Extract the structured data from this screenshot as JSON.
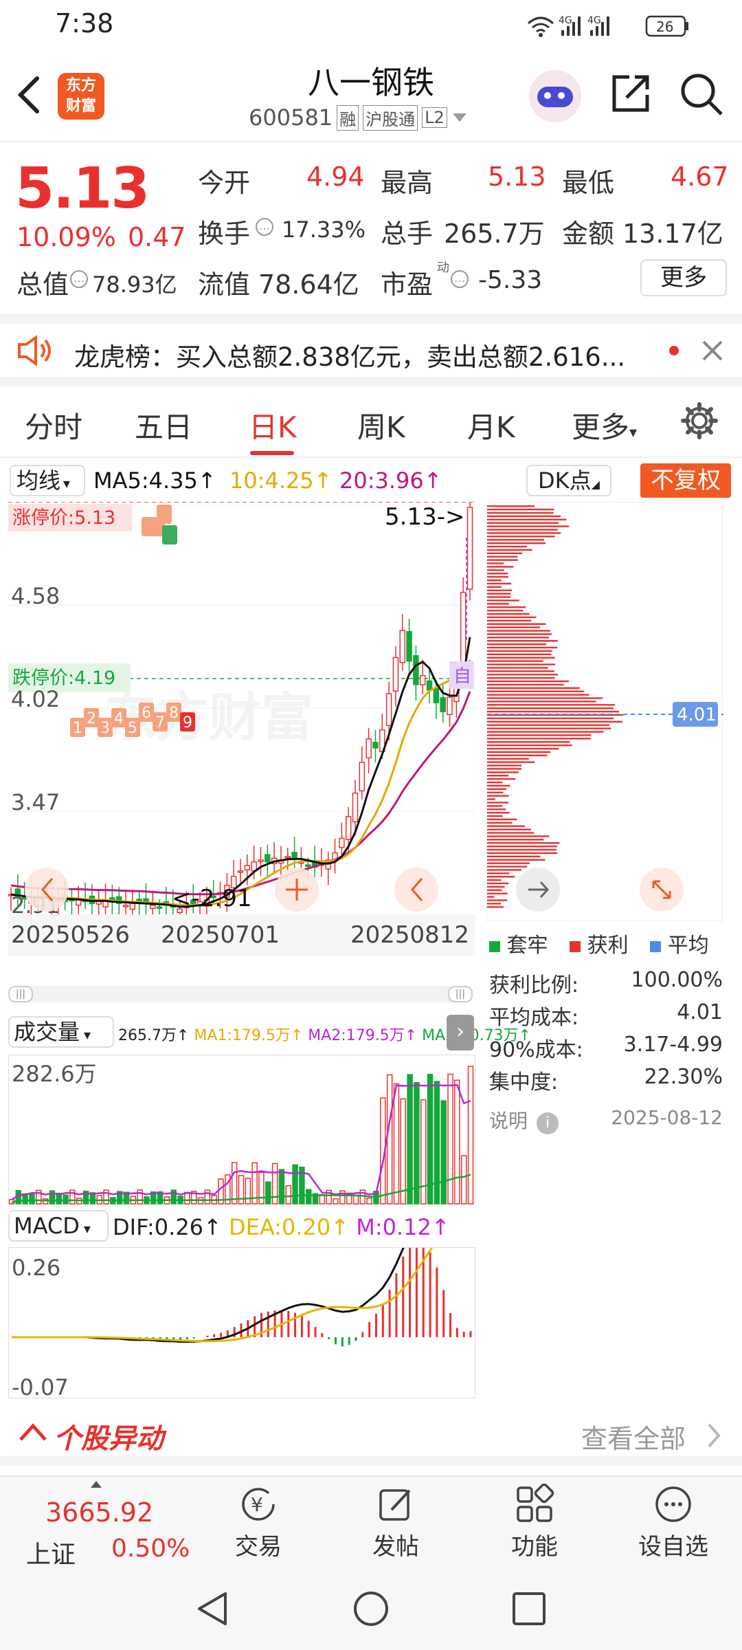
{
  "status": {
    "time": "7:38",
    "signal1": "4G",
    "signal2": "4G",
    "battery": "26"
  },
  "header": {
    "title": "八一钢铁",
    "code": "600581",
    "tag_margin": "融",
    "tag_connect": "沪股通",
    "tag_level": "L2",
    "logo_line1": "东方",
    "logo_line2": "财富"
  },
  "quote": {
    "price": "5.13",
    "change_pct": "10.09%",
    "change_amt": "0.47",
    "open_label": "今开",
    "open": "4.94",
    "high_label": "最高",
    "high": "5.13",
    "low_label": "最低",
    "low": "4.67",
    "turnover_label": "换手",
    "turnover": "17.33%",
    "volume_label": "总手",
    "volume": "265.7万",
    "amount_label": "金额",
    "amount": "13.17亿",
    "mktcap_label": "总值",
    "mktcap": "78.93亿",
    "float_label": "流值",
    "float": "78.64亿",
    "pe_label": "市盈",
    "pe_sup": "动",
    "pe": "-5.33",
    "more_button": "更多"
  },
  "notice": {
    "label": "龙虎榜：",
    "text": "买入总额2.838亿元，卖出总额2.616..."
  },
  "tabs": [
    {
      "label": "分时"
    },
    {
      "label": "五日"
    },
    {
      "label": "日K"
    },
    {
      "label": "周K"
    },
    {
      "label": "月K"
    },
    {
      "label": "更多"
    }
  ],
  "kline": {
    "indicator_select": "均线",
    "ma5": "MA5:4.35",
    "ma10": "10:4.25",
    "ma20": "20:3.96",
    "dk_button": "DK点",
    "adjust_button": "不复权",
    "limit_up_label": "涨停价:5.13",
    "limit_down_label": "跌停价:4.19",
    "price_labels": [
      "4.58",
      "4.02",
      "3.47",
      "2.91"
    ],
    "high_annot": "5.13->",
    "low_annot": "<-2.91",
    "dates": [
      "20250526",
      "20250701",
      "20250812"
    ],
    "nine_markers": [
      "1",
      "2",
      "3",
      "4",
      "5",
      "6",
      "7",
      "8",
      "9"
    ],
    "watermark": "东方财富",
    "today_marker": "自"
  },
  "chip": {
    "avg_cost_label": "4.01",
    "legend": [
      "套牢",
      "获利",
      "平均"
    ],
    "rows": [
      {
        "label": "获利比例:",
        "value": "100.00%"
      },
      {
        "label": "平均成本:",
        "value": "4.01"
      },
      {
        "label": "90%成本:",
        "value": "3.17-4.99"
      },
      {
        "label": "集中度:",
        "value": "22.30%"
      }
    ],
    "note_label": "说明",
    "date": "2025-08-12"
  },
  "volume": {
    "select": "成交量",
    "value": "265.7万",
    "ma1": "MA1:179.5万",
    "ma2": "MA2:179.5万",
    "ma3": "MA3:60.73万",
    "max_label": "282.6万"
  },
  "macd": {
    "select": "MACD",
    "dif": "DIF:0.26",
    "dea": "DEA:0.20",
    "m": "M:0.12",
    "top_label": "0.26",
    "bottom_label": "-0.07"
  },
  "movement": {
    "title": "个股异动",
    "view_all": "查看全部"
  },
  "bottom_bar": {
    "index_value": "3665.92",
    "index_name": "上证",
    "index_pct": "0.50%",
    "trade": "交易",
    "post": "发帖",
    "function": "功能",
    "watchlist": "设自选"
  },
  "colors": {
    "up": "#e8312e",
    "down": "#14a83b",
    "ma5": "#000000",
    "ma10": "#e6a800",
    "ma20": "#c0187a",
    "accent_orange": "#f05a22"
  }
}
